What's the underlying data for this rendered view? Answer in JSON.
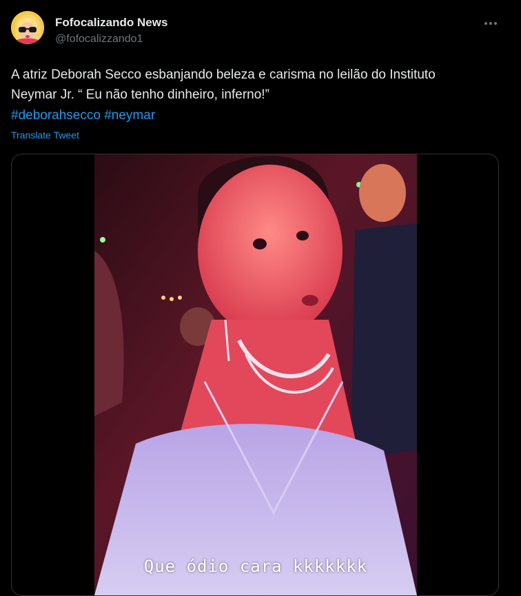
{
  "author": {
    "name": "Fofocalizando News",
    "handle": "@fofocalizzando1"
  },
  "tweet": {
    "text": "A atriz Deborah Secco esbanjando beleza e carisma no leilão do Instituto\nNeymar Jr. “ Eu não tenho dinheiro, inferno!”",
    "hashtags": [
      "#deborahsecco",
      "#neymar"
    ],
    "translate_label": "Translate Tweet"
  },
  "media": {
    "caption": "Que ódio cara kkkkkkk"
  },
  "icons": {
    "more": "more-options-icon",
    "avatar": "avatar-cartoon-woman"
  },
  "colors": {
    "background": "#000000",
    "text": "#e7e9ea",
    "secondary": "#71767b",
    "link": "#1d9bf0",
    "border": "#2f3336"
  }
}
